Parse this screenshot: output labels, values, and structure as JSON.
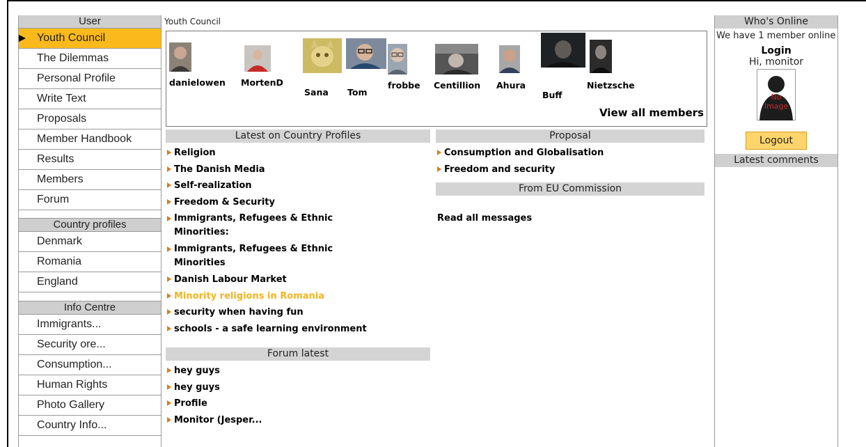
{
  "left_nav": {
    "user_header": "User",
    "user_items": [
      {
        "label": "Youth Council",
        "active": true
      },
      {
        "label": "The Dilemmas"
      },
      {
        "label": "Personal Profile"
      },
      {
        "label": "Write Text"
      },
      {
        "label": "Proposals"
      },
      {
        "label": "Member Handbook"
      },
      {
        "label": "Results"
      },
      {
        "label": "Members"
      },
      {
        "label": "Forum"
      }
    ],
    "country_header": "Country profiles",
    "country_items": [
      {
        "label": "Denmark"
      },
      {
        "label": "Romania"
      },
      {
        "label": "England"
      }
    ],
    "info_header": "Info Centre",
    "info_items": [
      {
        "label": "Immigrants..."
      },
      {
        "label": "Security ore..."
      },
      {
        "label": "Consumption..."
      },
      {
        "label": "Human Rights"
      },
      {
        "label": "Photo Gallery"
      },
      {
        "label": "Country Info..."
      }
    ]
  },
  "main": {
    "title": "Youth Council",
    "members": [
      "danielowen",
      "MortenD",
      "Sana",
      "Tom",
      "frobbe",
      "Centillion",
      "Ahura",
      "Buff",
      "Nietzsche"
    ],
    "view_all": "View all members",
    "country_profiles": {
      "header": "Latest on Country Profiles",
      "items": [
        "Religion",
        "The Danish Media",
        "Self-realization",
        "Freedom & Security",
        "Immigrants, Refugees & Ethnic Minorities:",
        "Immigrants, Refugees & Ethnic Minorities",
        "Danish Labour Market",
        "Minority religions in Romania",
        "security when having fun",
        "schools - a safe learning environment"
      ]
    },
    "proposal": {
      "header": "Proposal",
      "items": [
        "Consumption and Globalisation",
        "Freedom and security"
      ]
    },
    "eu": {
      "header": "From EU Commission",
      "read_all": "Read all messages"
    },
    "forum": {
      "header": "Forum latest",
      "items": [
        "hey guys",
        "hey guys",
        "Profile",
        "Monitor (Jesper..."
      ]
    }
  },
  "right": {
    "online_header": "Who's Online",
    "online_text": "We have 1 member online",
    "login_title": "Login",
    "greeting": "Hi, monitor",
    "avatar_text": "No Image",
    "logout_label": "Logout",
    "comments_header": "Latest comments"
  },
  "colors": {
    "active_nav": "#fbb91b",
    "header_gray": "#cfcfcf",
    "link_arrow": "#e07a17",
    "highlight_link": "#f6b41c",
    "logout_bg": "#ffd56b"
  }
}
